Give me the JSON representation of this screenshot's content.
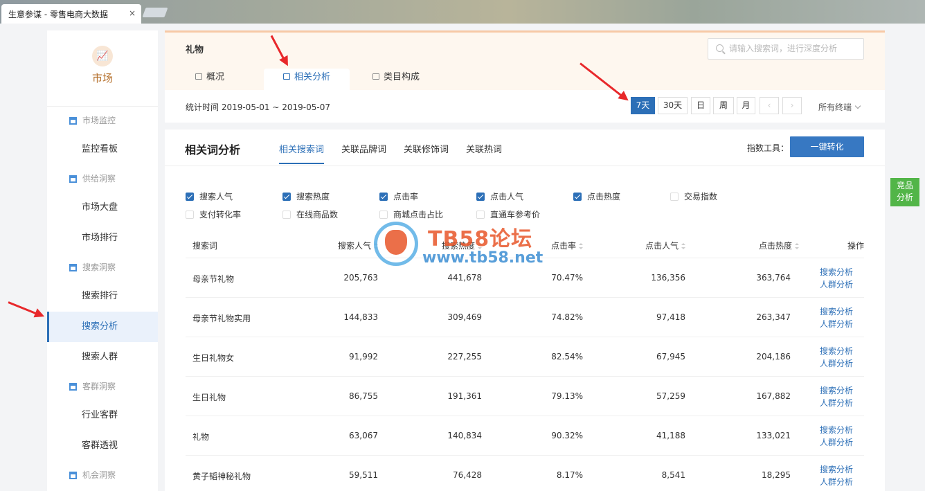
{
  "browser": {
    "tab_title": "生意参谋 - 零售电商大数据",
    "close": "×"
  },
  "sidebar": {
    "brand_icon": "📈",
    "brand": "市场",
    "groups": [
      {
        "label": "市场监控",
        "items": [
          "监控看板"
        ]
      },
      {
        "label": "供给洞察",
        "items": [
          "市场大盘",
          "市场排行"
        ]
      },
      {
        "label": "搜索洞察",
        "items": [
          "搜索排行",
          "搜索分析",
          "搜索人群"
        ]
      },
      {
        "label": "客群洞察",
        "items": [
          "行业客群",
          "客群透视"
        ]
      },
      {
        "label": "机会洞察",
        "items": []
      }
    ],
    "active_item": "搜索分析"
  },
  "header": {
    "title": "礼物",
    "search_placeholder": "请输入搜索词，进行深度分析",
    "tabs": [
      "概况",
      "相关分析",
      "类目构成"
    ],
    "active_tab": "相关分析",
    "stat_time": "统计时间 2019-05-01 ~ 2019-05-07",
    "ranges": [
      "7天",
      "30天",
      "日",
      "周",
      "月"
    ],
    "active_range": "7天",
    "prev": "‹",
    "next": "›",
    "terminal": "所有终端"
  },
  "main": {
    "title": "相关词分析",
    "subtabs": [
      "相关搜索词",
      "关联品牌词",
      "关联修饰词",
      "关联热词"
    ],
    "active_subtab": "相关搜索词",
    "tool_label": "指数工具：",
    "convert_button": "一键转化",
    "checkboxes": [
      {
        "label": "搜索人气",
        "checked": true
      },
      {
        "label": "搜索热度",
        "checked": true
      },
      {
        "label": "点击率",
        "checked": true
      },
      {
        "label": "点击人气",
        "checked": true
      },
      {
        "label": "点击热度",
        "checked": true
      },
      {
        "label": "交易指数",
        "checked": false
      },
      {
        "label": "支付转化率",
        "checked": false
      },
      {
        "label": "在线商品数",
        "checked": false
      },
      {
        "label": "商城点击占比",
        "checked": false
      },
      {
        "label": "直通车参考价",
        "checked": false
      }
    ],
    "columns": [
      "搜索词",
      "搜索人气",
      "搜索热度",
      "点击率",
      "点击人气",
      "点击热度",
      "操作"
    ],
    "rows": [
      {
        "word": "母亲节礼物",
        "search_pop": "205,763",
        "search_heat": "441,678",
        "ctr": "70.47%",
        "click_pop": "136,356",
        "click_heat": "363,764"
      },
      {
        "word": "母亲节礼物实用",
        "search_pop": "144,833",
        "search_heat": "309,469",
        "ctr": "74.82%",
        "click_pop": "97,418",
        "click_heat": "263,347"
      },
      {
        "word": "生日礼物女",
        "search_pop": "91,992",
        "search_heat": "227,255",
        "ctr": "82.54%",
        "click_pop": "67,945",
        "click_heat": "204,186"
      },
      {
        "word": "生日礼物",
        "search_pop": "86,755",
        "search_heat": "191,361",
        "ctr": "79.13%",
        "click_pop": "57,259",
        "click_heat": "167,882"
      },
      {
        "word": "礼物",
        "search_pop": "63,067",
        "search_heat": "140,834",
        "ctr": "90.32%",
        "click_pop": "41,188",
        "click_heat": "133,021"
      },
      {
        "word": "黄子韬神秘礼物",
        "search_pop": "59,511",
        "search_heat": "76,428",
        "ctr": "8.17%",
        "click_pop": "8,541",
        "click_heat": "18,295"
      }
    ],
    "op_links": [
      "搜索分析",
      "人群分析"
    ]
  },
  "float_button": {
    "line1": "竞品",
    "line2": "分析"
  },
  "watermark": {
    "text1": "TB58论坛",
    "text2": "www.tb58.net"
  },
  "colors": {
    "accent": "#2c6fb7",
    "brand": "#b5702c",
    "float": "#52b548",
    "arrow": "#e8282b"
  }
}
